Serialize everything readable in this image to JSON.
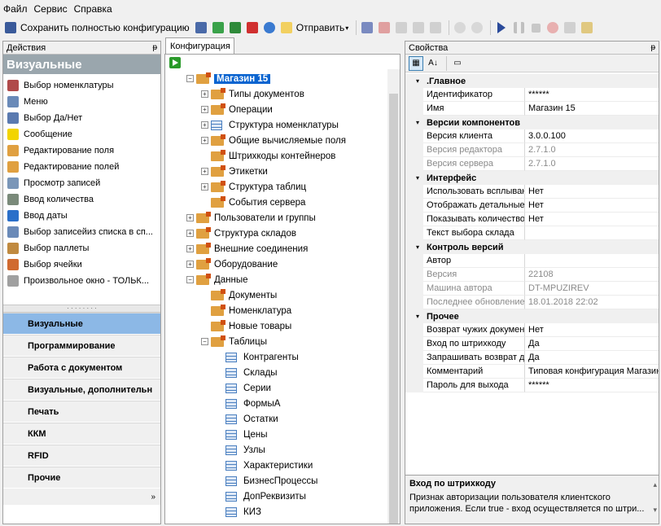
{
  "menu": [
    "Файл",
    "Сервис",
    "Справка"
  ],
  "toolbar": {
    "save_all_label": "Сохранить полностью конфигурацию",
    "send_label": "Отправить"
  },
  "left_panel": {
    "title": "Действия",
    "section_title": "Визуальные",
    "actions": [
      {
        "label": "Выбор номенклатуры",
        "icon": "barcode-icon",
        "color": "#b04a4a"
      },
      {
        "label": "Меню",
        "icon": "menu-icon",
        "color": "#6a8ab8"
      },
      {
        "label": "Выбор Да/Нет",
        "icon": "yes-no-icon",
        "color": "#5a7ab0"
      },
      {
        "label": "Сообщение",
        "icon": "message-icon",
        "color": "#f2d400"
      },
      {
        "label": "Редактирование поля",
        "icon": "edit-field-icon",
        "color": "#e0a040"
      },
      {
        "label": "Редактирование полей",
        "icon": "edit-fields-icon",
        "color": "#e0a040"
      },
      {
        "label": "Просмотр записей",
        "icon": "view-records-icon",
        "color": "#7a96b8"
      },
      {
        "label": "Ввод количества",
        "icon": "calculator-icon",
        "color": "#7a8a7a"
      },
      {
        "label": "Ввод даты",
        "icon": "date-icon",
        "color": "#2a6fc9"
      },
      {
        "label": "Выбор записейиз списка в сп...",
        "icon": "list-select-icon",
        "color": "#6a8ab8"
      },
      {
        "label": "Выбор паллеты",
        "icon": "pallet-icon",
        "color": "#c08a40"
      },
      {
        "label": "Выбор ячейки",
        "icon": "cell-icon",
        "color": "#d06a30"
      },
      {
        "label": "Произвольное окно - ТОЛЬК...",
        "icon": "window-icon",
        "color": "#a0a0a0"
      }
    ],
    "categories": [
      {
        "label": "Визуальные",
        "selected": true
      },
      {
        "label": "Программирование",
        "selected": false
      },
      {
        "label": "Работа с документом",
        "selected": false
      },
      {
        "label": "Визуальные, дополнительн",
        "selected": false
      },
      {
        "label": "Печать",
        "selected": false
      },
      {
        "label": "ККМ",
        "selected": false
      },
      {
        "label": "RFID",
        "selected": false
      },
      {
        "label": "Прочие",
        "selected": false
      }
    ]
  },
  "config_panel": {
    "tab_label": "Конфигурация",
    "tree": [
      {
        "label": "Магазин 15",
        "level": 0,
        "expand": "−",
        "icon": "folder",
        "selected": true
      },
      {
        "label": "Типы документов",
        "level": 1,
        "expand": "+",
        "icon": "folder"
      },
      {
        "label": "Операции",
        "level": 1,
        "expand": "+",
        "icon": "folder"
      },
      {
        "label": "Структура номенклатуры",
        "level": 1,
        "expand": "+",
        "icon": "table"
      },
      {
        "label": "Общие вычисляемые поля",
        "level": 1,
        "expand": "+",
        "icon": "folder"
      },
      {
        "label": "Штрихкоды контейнеров",
        "level": 1,
        "expand": "",
        "icon": "folder"
      },
      {
        "label": "Этикетки",
        "level": 1,
        "expand": "+",
        "icon": "folder"
      },
      {
        "label": "Структура таблиц",
        "level": 1,
        "expand": "+",
        "icon": "folder"
      },
      {
        "label": "События сервера",
        "level": 1,
        "expand": "",
        "icon": "folder"
      },
      {
        "label": "Пользователи и группы",
        "level": 0,
        "expand": "+",
        "icon": "folder"
      },
      {
        "label": "Структура складов",
        "level": 0,
        "expand": "+",
        "icon": "folder"
      },
      {
        "label": "Внешние соединения",
        "level": 0,
        "expand": "+",
        "icon": "folder"
      },
      {
        "label": "Оборудование",
        "level": 0,
        "expand": "+",
        "icon": "folder"
      },
      {
        "label": "Данные",
        "level": 0,
        "expand": "−",
        "icon": "folder"
      },
      {
        "label": "Документы",
        "level": 1,
        "expand": "",
        "icon": "folder"
      },
      {
        "label": "Номенклатура",
        "level": 1,
        "expand": "",
        "icon": "folder"
      },
      {
        "label": "Новые товары",
        "level": 1,
        "expand": "",
        "icon": "folder"
      },
      {
        "label": "Таблицы",
        "level": 1,
        "expand": "−",
        "icon": "folder"
      },
      {
        "label": "Контрагенты",
        "level": 2,
        "expand": "",
        "icon": "table"
      },
      {
        "label": "Склады",
        "level": 2,
        "expand": "",
        "icon": "table"
      },
      {
        "label": "Серии",
        "level": 2,
        "expand": "",
        "icon": "table"
      },
      {
        "label": "ФормыА",
        "level": 2,
        "expand": "",
        "icon": "table"
      },
      {
        "label": "Остатки",
        "level": 2,
        "expand": "",
        "icon": "table"
      },
      {
        "label": "Цены",
        "level": 2,
        "expand": "",
        "icon": "table"
      },
      {
        "label": "Узлы",
        "level": 2,
        "expand": "",
        "icon": "table"
      },
      {
        "label": "Характеристики",
        "level": 2,
        "expand": "",
        "icon": "table"
      },
      {
        "label": "БизнесПроцессы",
        "level": 2,
        "expand": "",
        "icon": "table"
      },
      {
        "label": "ДопРеквизиты",
        "level": 2,
        "expand": "",
        "icon": "table"
      },
      {
        "label": "КИЗ",
        "level": 2,
        "expand": "",
        "icon": "table"
      }
    ]
  },
  "properties": {
    "title": "Свойства",
    "groups": [
      {
        "name": ".Главное",
        "rows": [
          {
            "k": "Идентификатор",
            "v": "******"
          },
          {
            "k": "Имя",
            "v": "Магазин 15"
          }
        ]
      },
      {
        "name": "Версии компонентов",
        "rows": [
          {
            "k": "Версия клиента",
            "v": "3.0.0.100"
          },
          {
            "k": "Версия редактора",
            "v": "2.7.1.0",
            "dim": true
          },
          {
            "k": "Версия сервера",
            "v": "2.7.1.0",
            "dim": true
          }
        ]
      },
      {
        "name": "Интерфейс",
        "rows": [
          {
            "k": "Использовать всплывающ",
            "v": "Нет"
          },
          {
            "k": "Отображать детальные",
            "v": "Нет"
          },
          {
            "k": "Показывать количество",
            "v": "Нет"
          },
          {
            "k": "Текст выбора склада",
            "v": ""
          }
        ]
      },
      {
        "name": "Контроль версий",
        "rows": [
          {
            "k": "Автор",
            "v": ""
          },
          {
            "k": "Версия",
            "v": "22108",
            "dim": true
          },
          {
            "k": "Машина автора",
            "v": "DT-MPUZIREV",
            "dim": true
          },
          {
            "k": "Последнее обновление",
            "v": "18.01.2018 22:02",
            "dim": true
          }
        ]
      },
      {
        "name": "Прочее",
        "rows": [
          {
            "k": "Возврат чужих документ",
            "v": "Нет"
          },
          {
            "k": "Вход по штрихкоду",
            "v": "Да"
          },
          {
            "k": "Запрашивать возврат д",
            "v": "Да"
          },
          {
            "k": "Комментарий",
            "v": "Типовая конфигурация Магазин"
          },
          {
            "k": "Пароль для выхода",
            "v": "******"
          }
        ]
      }
    ],
    "description_title": "Вход по штрихкоду",
    "description_text": "Признак авторизации пользователя клиентского приложения. Если true - вход осуществляется по штри..."
  }
}
